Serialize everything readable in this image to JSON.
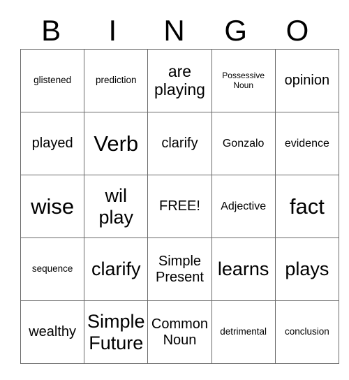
{
  "card": {
    "title": "BINGO",
    "header_letters": [
      "B",
      "I",
      "N",
      "G",
      "O"
    ],
    "free_label": "FREE!",
    "colors": {
      "background": "#ffffff",
      "text": "#000000",
      "grid_line": "#6b6b6b"
    },
    "grid": {
      "columns": 5,
      "rows": 5,
      "cells": [
        [
          {
            "text": "glistened",
            "size": "xs"
          },
          {
            "text": "prediction",
            "size": "xs"
          },
          {
            "text": "are playing",
            "size": "lg"
          },
          {
            "text": "Possessive Noun",
            "size": "xxs"
          },
          {
            "text": "opinion",
            "size": "md"
          }
        ],
        [
          {
            "text": "played",
            "size": "md"
          },
          {
            "text": "Verb",
            "size": "xxl"
          },
          {
            "text": "clarify",
            "size": "md"
          },
          {
            "text": "Gonzalo",
            "size": "sm"
          },
          {
            "text": "evidence",
            "size": "sm"
          }
        ],
        [
          {
            "text": "wise",
            "size": "xxl"
          },
          {
            "text": "wil play",
            "size": "xl"
          },
          {
            "text": "FREE!",
            "size": "md"
          },
          {
            "text": "Adjective",
            "size": "sm"
          },
          {
            "text": "fact",
            "size": "xxl"
          }
        ],
        [
          {
            "text": "sequence",
            "size": "xs"
          },
          {
            "text": "clarify",
            "size": "xl"
          },
          {
            "text": "Simple Present",
            "size": "md"
          },
          {
            "text": "learns",
            "size": "xl"
          },
          {
            "text": "plays",
            "size": "xl"
          }
        ],
        [
          {
            "text": "wealthy",
            "size": "md"
          },
          {
            "text": "Simple Future",
            "size": "xl"
          },
          {
            "text": "Common Noun",
            "size": "md"
          },
          {
            "text": "detrimental",
            "size": "xs"
          },
          {
            "text": "conclusion",
            "size": "xs"
          }
        ]
      ]
    }
  }
}
